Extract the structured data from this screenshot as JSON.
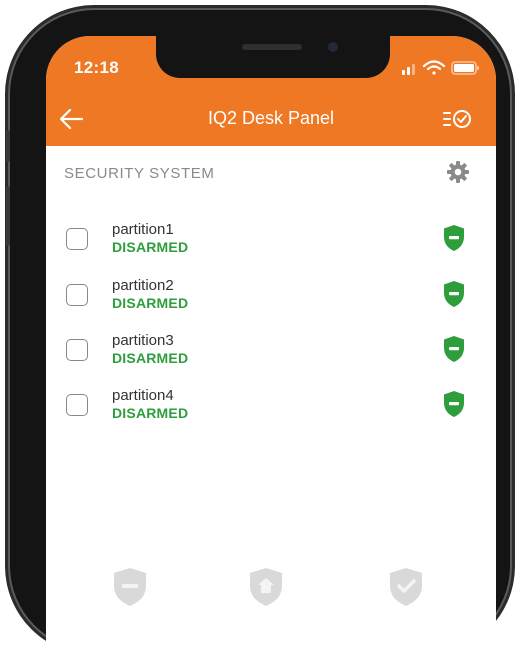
{
  "status_bar": {
    "time": "12:18"
  },
  "header": {
    "title": "IQ2 Desk Panel",
    "back_icon": "arrow-left-icon",
    "action_icon": "list-check-icon"
  },
  "section": {
    "title": "SECURITY SYSTEM",
    "settings_icon": "gear-icon"
  },
  "partitions": [
    {
      "name": "partition1",
      "status": "DISARMED"
    },
    {
      "name": "partition2",
      "status": "DISARMED"
    },
    {
      "name": "partition3",
      "status": "DISARMED"
    },
    {
      "name": "partition4",
      "status": "DISARMED"
    }
  ],
  "bottom_actions": [
    {
      "icon": "disarm-shield-icon"
    },
    {
      "icon": "arm-stay-shield-icon"
    },
    {
      "icon": "arm-away-shield-icon"
    }
  ],
  "colors": {
    "brand_orange": "#ee7823",
    "disarmed_green": "#2e9e3d",
    "muted_gray": "#8a8a8a"
  }
}
